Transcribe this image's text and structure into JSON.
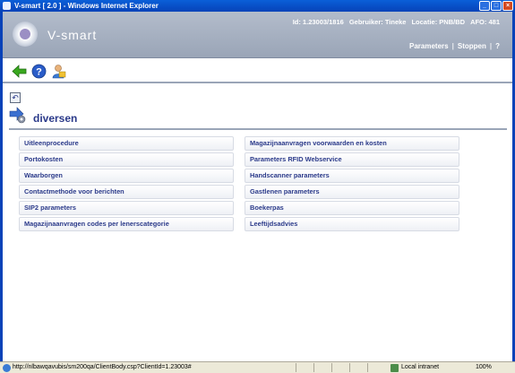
{
  "window": {
    "title": "V-smart [ 2.0 ] - Windows Internet Explorer"
  },
  "header": {
    "logo_text": "V-smart",
    "id_text": "Id: 1.23003/1816",
    "user_text": "Gebruiker: Tineke",
    "location_text": "Locatie: PNB/BD",
    "afo_text": "AFO: 481",
    "links": {
      "parameters": "Parameters",
      "stoppen": "Stoppen",
      "help": "?"
    }
  },
  "toolbar": {
    "icons": [
      "back-arrow-icon",
      "help-icon",
      "user-icon"
    ]
  },
  "section": {
    "title": "diversen"
  },
  "menu": {
    "left": [
      "Uitleenprocedure",
      "Portokosten",
      "Waarborgen",
      "Contactmethode voor berichten",
      "SIP2 parameters",
      "Magazijnaanvragen codes per lenerscategorie"
    ],
    "right": [
      "Magazijnaanvragen voorwaarden en kosten",
      "Parameters RFID Webservice",
      "Handscanner parameters",
      "Gastlenen parameters",
      "Boekerpas",
      "Leeftijdsadvies"
    ]
  },
  "status": {
    "url": "http://nlbawqavubis/sm200qa/ClientBody.csp?ClientId=1.23003#",
    "zone": "Local intranet",
    "zoom": "100%"
  },
  "colors": {
    "accent": "#2b3a8a",
    "header_bg": "#a5afc0",
    "title_bar": "#0a5fd8"
  }
}
